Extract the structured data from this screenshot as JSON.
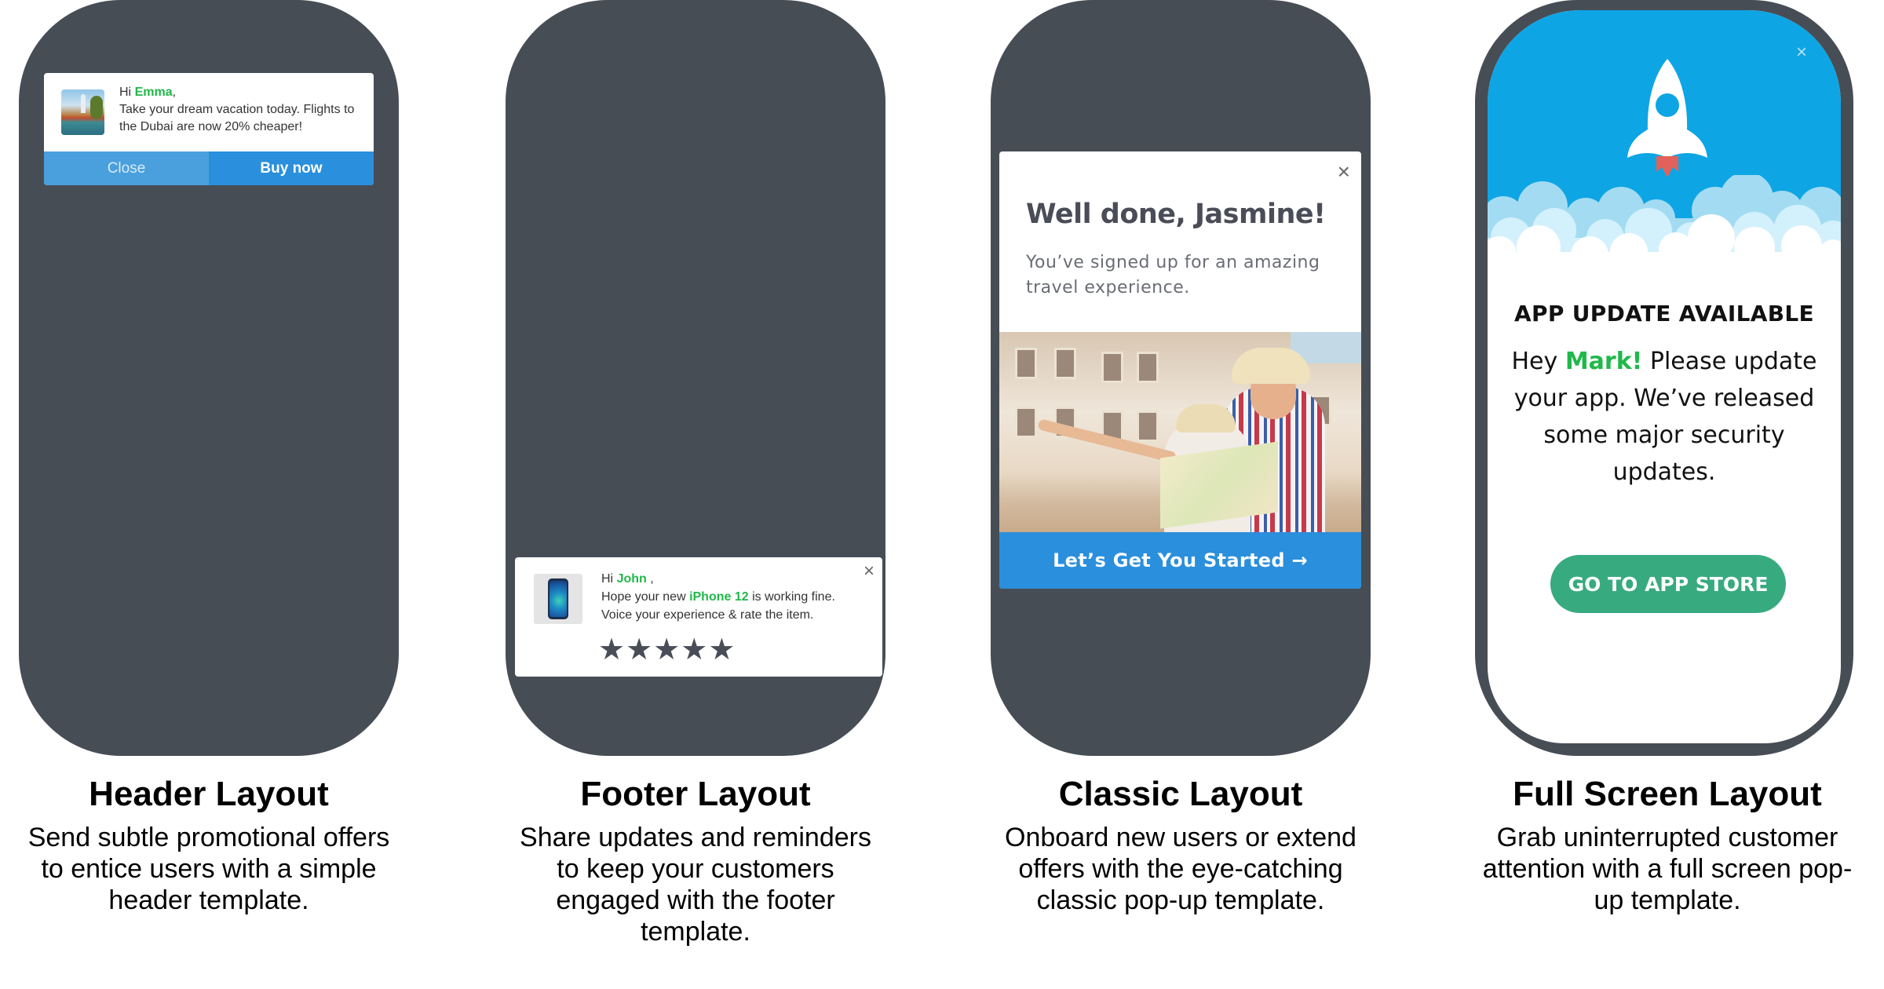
{
  "colors": {
    "phone": "#474d55",
    "accent_green": "#20b84a",
    "primary_blue": "#2a8fdc",
    "sky_blue": "#0ea5e4",
    "store_green": "#37aa80"
  },
  "cards": [
    {
      "title": "Header Layout",
      "description": "Send subtle promotional offers to entice users with a simple header template.",
      "popup": {
        "greeting_prefix": "Hi ",
        "name": "Emma",
        "greeting_suffix": ",",
        "message": "Take your dream vacation today. Flights to the Dubai are now 20% cheaper!",
        "thumbnail": "dubai-photo",
        "close_label": "Close",
        "buy_label": "Buy now"
      }
    },
    {
      "title": "Footer Layout",
      "description": "Share updates and reminders to keep your customers engaged with the footer template.",
      "popup": {
        "greeting_prefix": "Hi ",
        "name": "John",
        "greeting_suffix": " ,",
        "line2_prefix": "Hope your new ",
        "product": "iPhone 12",
        "line2_suffix": " is working fine.",
        "line3": "Voice your experience & rate the item.",
        "thumbnail": "iphone-photo",
        "close_icon": "×",
        "rating_max": 5,
        "star_glyph": "★"
      }
    },
    {
      "title": "Classic Layout",
      "description": "Onboard new users or extend offers with the eye-catching classic pop-up template.",
      "popup": {
        "heading": "Well done, Jasmine!",
        "subtext": "You’ve signed up for an amazing travel experience.",
        "image": "travel-couple-photo",
        "cta_label": "Let’s Get You Started →",
        "close_icon": "×"
      }
    },
    {
      "title": "Full Screen Layout",
      "description": "Grab uninterrupted customer attention with a full screen pop-up template.",
      "popup": {
        "heading": "APP UPDATE AVAILABLE",
        "msg_prefix": "Hey ",
        "name": "Mark!",
        "msg_suffix": " Please update your app. We’ve released some major security updates.",
        "cta_label": "GO TO APP STORE",
        "close_icon": "×",
        "illustration": "rocket-icon"
      }
    }
  ]
}
